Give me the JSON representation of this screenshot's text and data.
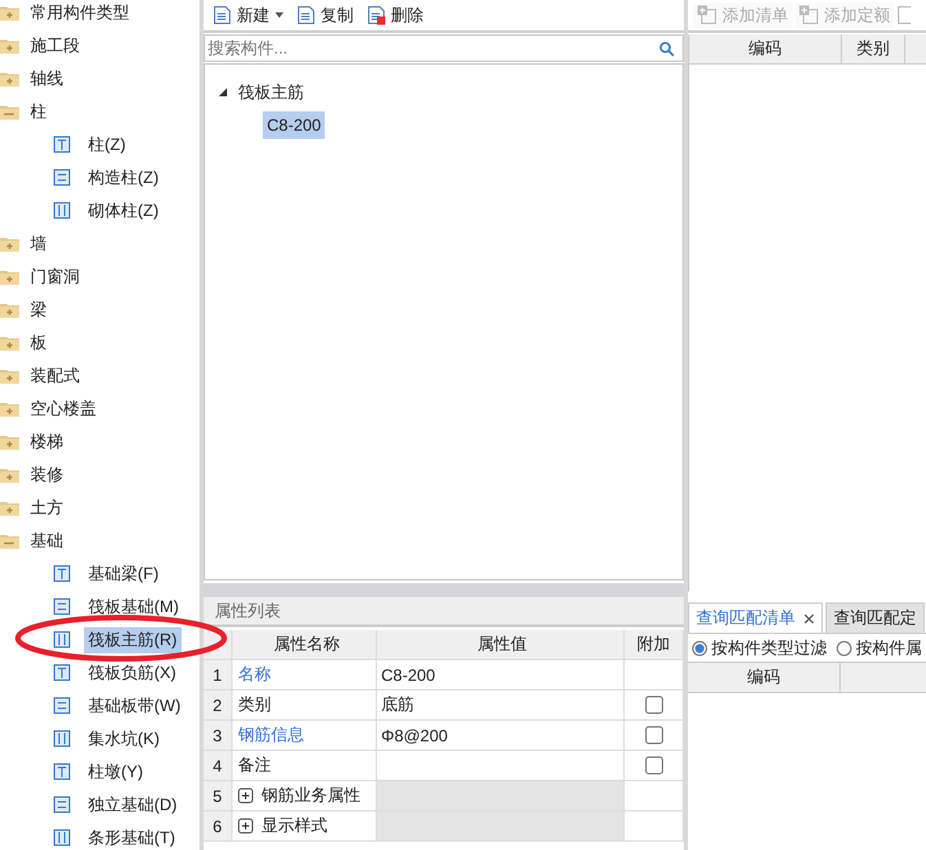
{
  "component_tree": [
    {
      "label": "常用构件类型",
      "expanded": false
    },
    {
      "label": "施工段",
      "expanded": false
    },
    {
      "label": "轴线",
      "expanded": false
    },
    {
      "label": "柱",
      "expanded": true,
      "children": [
        {
          "label": "柱(Z)",
          "selected": false
        },
        {
          "label": "构造柱(Z)",
          "selected": false
        },
        {
          "label": "砌体柱(Z)",
          "selected": false
        }
      ]
    },
    {
      "label": "墙",
      "expanded": false
    },
    {
      "label": "门窗洞",
      "expanded": false
    },
    {
      "label": "梁",
      "expanded": false
    },
    {
      "label": "板",
      "expanded": false
    },
    {
      "label": "装配式",
      "expanded": false
    },
    {
      "label": "空心楼盖",
      "expanded": false
    },
    {
      "label": "楼梯",
      "expanded": false
    },
    {
      "label": "装修",
      "expanded": false
    },
    {
      "label": "土方",
      "expanded": false
    },
    {
      "label": "基础",
      "expanded": true,
      "children": [
        {
          "label": "基础梁(F)",
          "selected": false
        },
        {
          "label": "筏板基础(M)",
          "selected": false
        },
        {
          "label": "筏板主筋(R)",
          "selected": true
        },
        {
          "label": "筏板负筋(X)",
          "selected": false
        },
        {
          "label": "基础板带(W)",
          "selected": false
        },
        {
          "label": "集水坑(K)",
          "selected": false
        },
        {
          "label": "柱墩(Y)",
          "selected": false
        },
        {
          "label": "独立基础(D)",
          "selected": false
        },
        {
          "label": "条形基础(T)",
          "selected": false
        }
      ]
    }
  ],
  "component_toolbar": [
    {
      "label": "新建",
      "dropdown": true
    },
    {
      "label": "复制",
      "dropdown": false
    },
    {
      "label": "删除",
      "dropdown": false
    }
  ],
  "search": {
    "placeholder": "搜索构件..."
  },
  "component_list": [
    {
      "label": "筏板主筋",
      "expanded": true,
      "children": [
        {
          "label": "C8-200",
          "selected": true
        }
      ]
    }
  ],
  "properties": {
    "title": "属性列表",
    "columns": [
      "属性名称",
      "属性值",
      "附加"
    ],
    "rows": [
      {
        "kind": "field",
        "number": "1",
        "name": "名称",
        "link": true,
        "value": "C8-200"
      },
      {
        "kind": "field",
        "number": "2",
        "name": "类别",
        "link": false,
        "value": "底筋",
        "checked": false
      },
      {
        "kind": "field",
        "number": "3",
        "name": "钢筋信息",
        "link": true,
        "value": "Φ8@200",
        "checked": false
      },
      {
        "kind": "field",
        "number": "4",
        "name": "备注",
        "link": false,
        "checked": false
      },
      {
        "kind": "group",
        "number": "5",
        "name": "钢筋业务属性",
        "link": false
      },
      {
        "kind": "group",
        "number": "6",
        "name": "显示样式",
        "link": false
      }
    ]
  },
  "list_toolbar": [
    {
      "label": "添加清单",
      "disabled": true
    },
    {
      "label": "添加定额",
      "disabled": true
    }
  ],
  "list_table": {
    "columns": [
      "编码",
      "类别"
    ]
  },
  "query_tabs": [
    {
      "label": "查询匹配清单",
      "selected": true,
      "closable": true
    },
    {
      "label": "查询匹配定",
      "selected": false,
      "closable": false
    }
  ],
  "filter_options": [
    {
      "label": "按构件类型过滤",
      "selected": true
    },
    {
      "label": "按构件属",
      "selected": false
    }
  ],
  "query_table": {
    "columns": [
      "编码"
    ]
  }
}
